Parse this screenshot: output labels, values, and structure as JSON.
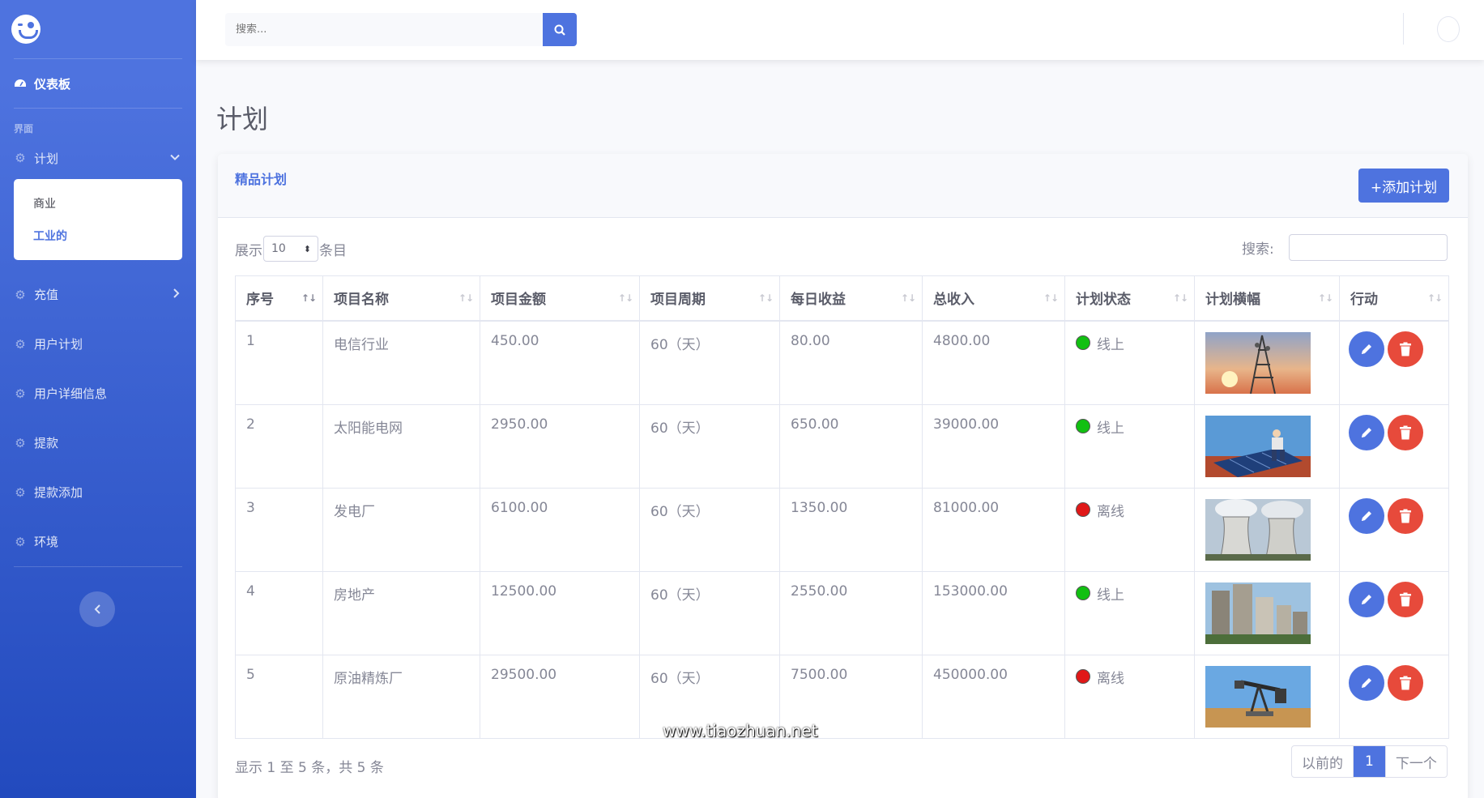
{
  "sidebar": {
    "dashboard": "仪表板",
    "heading": "界面",
    "plan": "计划",
    "sub_items": [
      "商业",
      "工业的"
    ],
    "items": [
      "充值",
      "用户计划",
      "用户详细信息",
      "提款",
      "提款添加",
      "环境"
    ]
  },
  "topbar": {
    "search_placeholder": "搜索..."
  },
  "page": {
    "title": "计划"
  },
  "card": {
    "title": "精品计划",
    "add_label": "+添加计划"
  },
  "controls": {
    "show": "展示",
    "length": "10",
    "entries": "条目",
    "search_label": "搜索:"
  },
  "table": {
    "headers": [
      "序号",
      "项目名称",
      "项目金额",
      "项目周期",
      "每日收益",
      "总收入",
      "计划状态",
      "计划横幅",
      "行动"
    ],
    "rows": [
      {
        "id": "1",
        "name": "电信行业",
        "amount": "450.00",
        "period": "60（天）",
        "daily": "80.00",
        "total": "4800.00",
        "status": "线上",
        "online": true,
        "banner": "telecom-tower"
      },
      {
        "id": "2",
        "name": "太阳能电网",
        "amount": "2950.00",
        "period": "60（天）",
        "daily": "650.00",
        "total": "39000.00",
        "status": "线上",
        "online": true,
        "banner": "solar-panel"
      },
      {
        "id": "3",
        "name": "发电厂",
        "amount": "6100.00",
        "period": "60（天）",
        "daily": "1350.00",
        "total": "81000.00",
        "status": "离线",
        "online": false,
        "banner": "power-plant"
      },
      {
        "id": "4",
        "name": "房地产",
        "amount": "12500.00",
        "period": "60（天）",
        "daily": "2550.00",
        "total": "153000.00",
        "status": "线上",
        "online": true,
        "banner": "buildings"
      },
      {
        "id": "5",
        "name": "原油精炼厂",
        "amount": "29500.00",
        "period": "60（天）",
        "daily": "7500.00",
        "total": "450000.00",
        "status": "离线",
        "online": false,
        "banner": "oil-pump"
      }
    ]
  },
  "footer": {
    "info": "显示 1 至 5 条，共 5 条",
    "prev": "以前的",
    "page": "1",
    "next": "下一个"
  },
  "watermark": "www.tiaozhuan.net",
  "colors": {
    "primary": "#4e73df",
    "danger": "#e74a3b",
    "online": "#11c011",
    "offline": "#e01818"
  }
}
